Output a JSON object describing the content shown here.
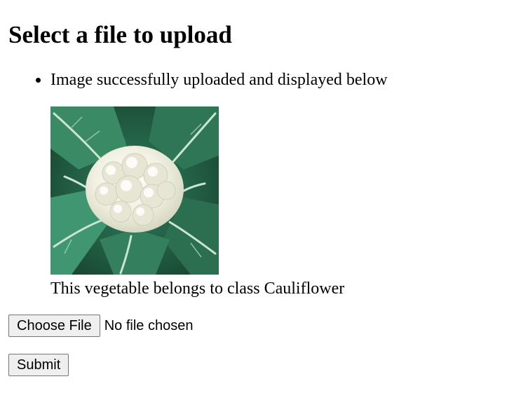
{
  "page": {
    "title": "Select a file to upload"
  },
  "messages": [
    "Image successfully uploaded and displayed below"
  ],
  "result": {
    "image_icon": "cauliflower-image",
    "caption": "This vegetable belongs to class Cauliflower"
  },
  "form": {
    "choose_file_label": "Choose File",
    "file_status": "No file chosen",
    "submit_label": "Submit"
  },
  "colors": {
    "leaf_dark": "#1f5a3c",
    "leaf_mid": "#2f8060",
    "leaf_light": "#7fbf99",
    "curd": "#f3f2e6",
    "button_bg": "#efefef",
    "button_border": "#767676"
  }
}
